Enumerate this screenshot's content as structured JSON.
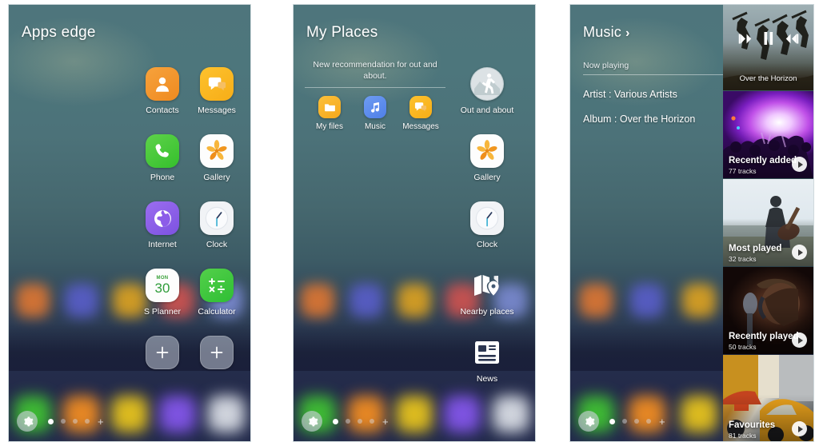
{
  "panels": [
    {
      "id": "apps-edge",
      "title": "Apps edge",
      "apps": [
        {
          "name": "Contacts",
          "icon": "contacts-icon"
        },
        {
          "name": "Messages",
          "icon": "messages-icon"
        },
        {
          "name": "Phone",
          "icon": "phone-icon"
        },
        {
          "name": "Gallery",
          "icon": "gallery-icon"
        },
        {
          "name": "Internet",
          "icon": "internet-icon"
        },
        {
          "name": "Clock",
          "icon": "clock-icon"
        },
        {
          "name": "S Planner",
          "icon": "calendar-icon",
          "day": "MON",
          "date": "30"
        },
        {
          "name": "Calculator",
          "icon": "calculator-icon"
        },
        {
          "name": "",
          "icon": "plus-icon"
        },
        {
          "name": "",
          "icon": "plus-icon"
        }
      ],
      "edgebar": {
        "gear": "gear-icon",
        "dots": 4,
        "active_dot": 0,
        "plus": "+"
      }
    },
    {
      "id": "my-places",
      "title": "My Places",
      "recommendation": {
        "text": "New recommendation for out and about.",
        "apps": [
          {
            "name": "My files",
            "icon": "folder-icon"
          },
          {
            "name": "Music",
            "icon": "music-note-icon"
          },
          {
            "name": "Messages",
            "icon": "messages-icon"
          }
        ]
      },
      "apps": [
        {
          "name": "Out and about",
          "icon": "walking-person-icon"
        },
        {
          "name": "Gallery",
          "icon": "gallery-icon"
        },
        {
          "name": "Clock",
          "icon": "clock-icon"
        },
        {
          "name": "Nearby places",
          "icon": "map-pin-icon"
        },
        {
          "name": "News",
          "icon": "news-icon"
        }
      ],
      "edgebar": {
        "gear": "gear-icon",
        "dots": 4,
        "active_dot": 0,
        "plus": "+"
      }
    },
    {
      "id": "music",
      "title": "Music",
      "chevron": "›",
      "now_playing_label": "Now playing",
      "artist_line": "Artist : Various Artists",
      "album_line": "Album : Over the Horizon",
      "thumbnails": [
        {
          "title": "Over the Horizon",
          "tracks": "",
          "kind": "now-playing",
          "controls": [
            "prev-icon",
            "pause-icon",
            "next-icon"
          ]
        },
        {
          "title": "Recently added",
          "tracks": "77 tracks",
          "kind": "playlist"
        },
        {
          "title": "Most played",
          "tracks": "32 tracks",
          "kind": "playlist"
        },
        {
          "title": "Recently played",
          "tracks": "50 tracks",
          "kind": "playlist"
        },
        {
          "title": "Favourites",
          "tracks": "81 tracks",
          "kind": "playlist"
        }
      ],
      "edgebar": {
        "gear": "gear-icon",
        "dots": 4,
        "active_dot": 0,
        "plus": "+"
      }
    }
  ],
  "colors": {
    "panel_top": "#4e757c",
    "panel_bottom": "#222a4b",
    "accent_orange": "#f3921f",
    "accent_green": "#3ec42f",
    "accent_purple": "#8a5ee8",
    "accent_yellow": "#f9b714",
    "text_light": "#ffffff"
  }
}
